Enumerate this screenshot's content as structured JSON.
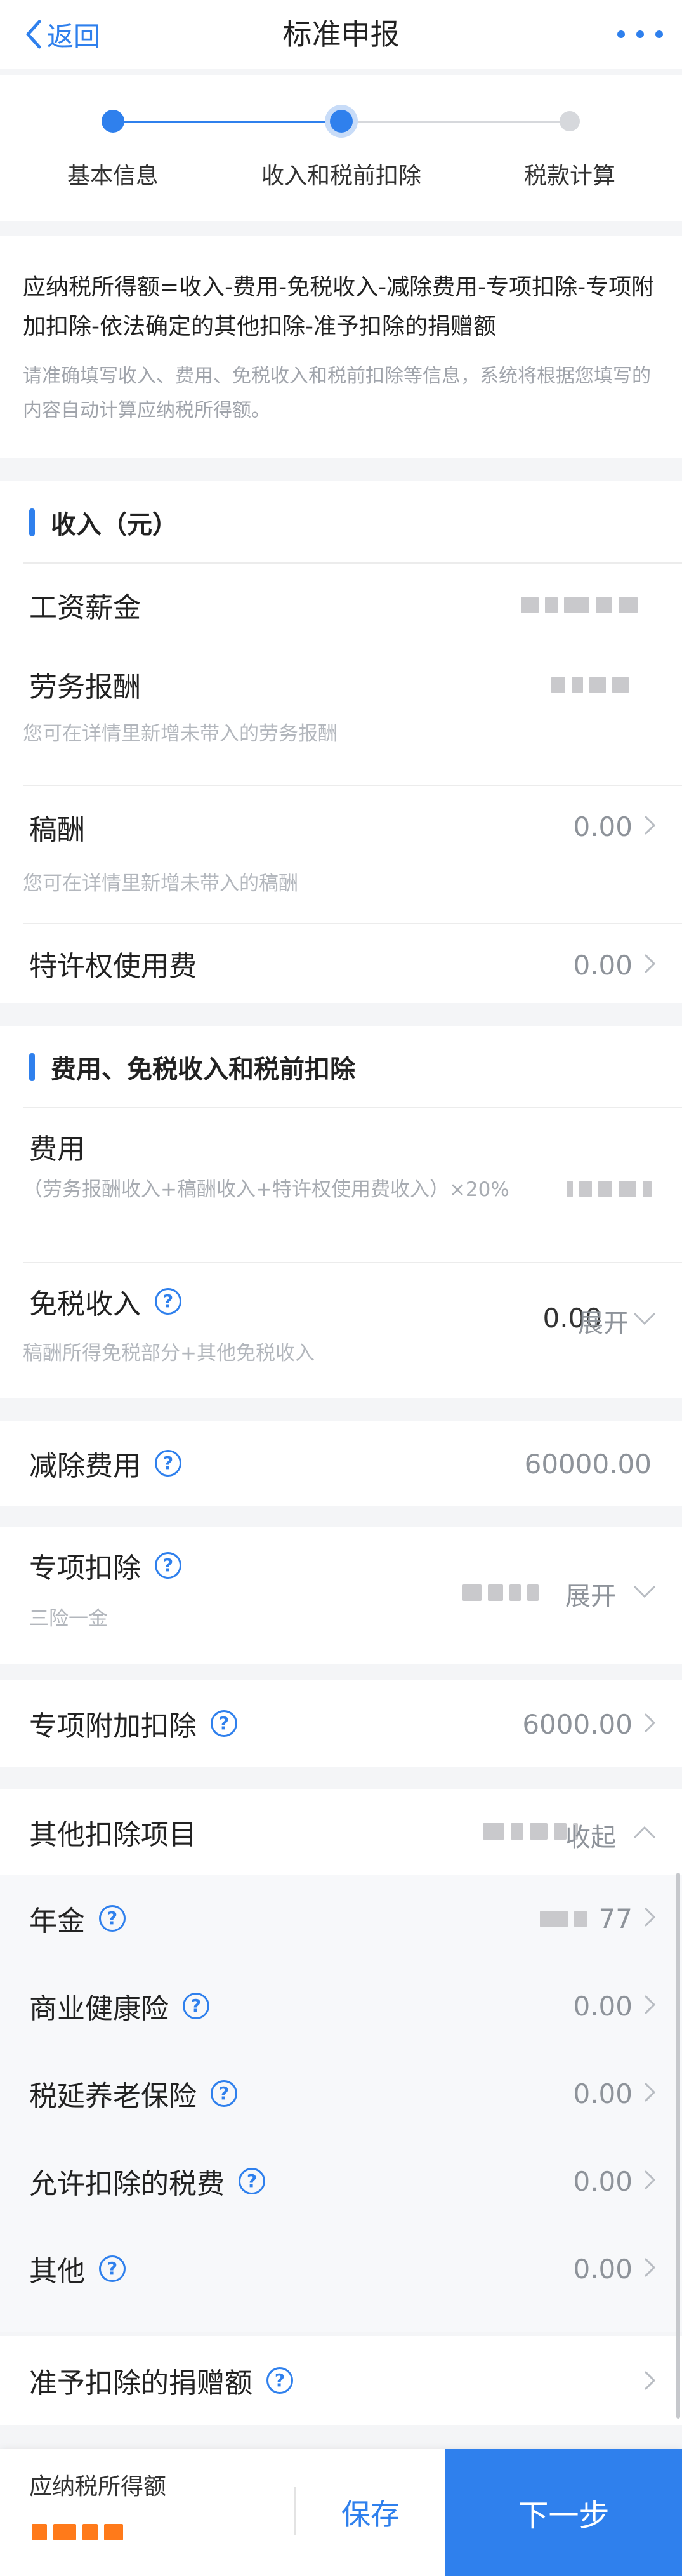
{
  "header": {
    "back_label": "返回",
    "title": "标准申报"
  },
  "steps": [
    {
      "label": "基本信息",
      "state": "done"
    },
    {
      "label": "收入和税前扣除",
      "state": "current"
    },
    {
      "label": "税款计算",
      "state": "pending"
    }
  ],
  "formula": {
    "text": "应纳税所得额=收入-费用-免税收入-减除费用-专项扣除-专项附加扣除-依法确定的其他扣除-准予扣除的捐赠额",
    "note": "请准确填写收入、费用、免税收入和税前扣除等信息，系统将根据您填写的内容自动计算应纳税所得额。"
  },
  "income": {
    "title": "收入（元）",
    "salary_label": "工资薪金",
    "labor_label": "劳务报酬",
    "labor_hint": "您可在详情里新增未带入的劳务报酬",
    "royalty_label": "稿酬",
    "royalty_value": "0.00",
    "royalty_hint": "您可在详情里新增未带入的稿酬",
    "franchise_label": "特许权使用费",
    "franchise_value": "0.00"
  },
  "deductions": {
    "title": "费用、免税收入和税前扣除",
    "expense_label": "费用",
    "expense_hint": "（劳务报酬收入+稿酬收入+特许权使用费收入）×20%",
    "taxfree_label": "免税收入",
    "taxfree_hint": "稿酬所得免税部分+其他免税收入",
    "taxfree_value": "0.00",
    "taxfree_expand": "展开",
    "standard_label": "减除费用",
    "standard_value": "60000.00",
    "special_label": "专项扣除",
    "special_hint": "三险一金",
    "special_expand": "展开",
    "additional_label": "专项附加扣除",
    "additional_value": "6000.00",
    "other_label": "其他扣除项目",
    "other_collapse": "收起",
    "other_items": [
      {
        "label": "年金",
        "value": "77"
      },
      {
        "label": "商业健康险",
        "value": "0.00"
      },
      {
        "label": "税延养老保险",
        "value": "0.00"
      },
      {
        "label": "允许扣除的税费",
        "value": "0.00"
      },
      {
        "label": "其他",
        "value": "0.00"
      }
    ],
    "donation_label": "准予扣除的捐赠额"
  },
  "footer": {
    "taxable_label": "应纳税所得额",
    "save_label": "保存",
    "next_label": "下一步"
  },
  "colors": {
    "accent": "#2f80ed",
    "taxable_amount": "#ff7a1a"
  }
}
